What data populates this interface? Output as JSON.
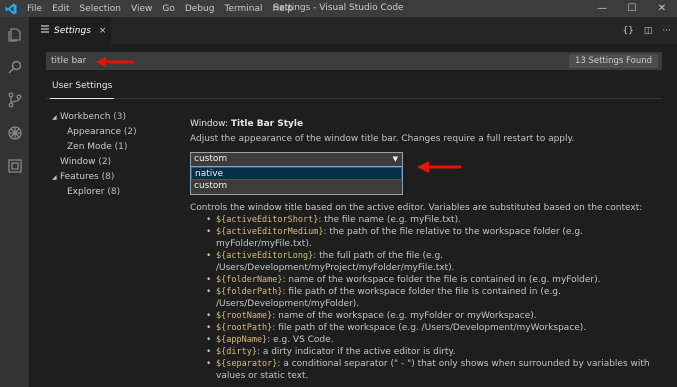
{
  "window": {
    "title": "Settings - Visual Studio Code",
    "menu": [
      "File",
      "Edit",
      "Selection",
      "View",
      "Go",
      "Debug",
      "Terminal",
      "Help"
    ],
    "controls": [
      "—",
      "☐",
      "✕"
    ]
  },
  "activity_bar": {
    "icons": [
      "explorer-icon",
      "search-icon",
      "source-control-icon",
      "debug-icon",
      "extensions-icon"
    ]
  },
  "tab": {
    "label": "Settings",
    "close": "×",
    "actions": [
      "{}",
      "◫",
      "···"
    ]
  },
  "search": {
    "value": "title bar",
    "count": "13 Settings Found"
  },
  "scope_tab": "User Settings",
  "toc": [
    {
      "arrow": "◢",
      "label": "Workbench",
      "count": "(3)",
      "indent": 0
    },
    {
      "arrow": "",
      "label": "Appearance",
      "count": "(2)",
      "indent": 1
    },
    {
      "arrow": "",
      "label": "Zen Mode",
      "count": "(1)",
      "indent": 1
    },
    {
      "arrow": "",
      "label": "Window",
      "count": "(2)",
      "indent": 0
    },
    {
      "arrow": "◢",
      "label": "Features",
      "count": "(8)",
      "indent": 0
    },
    {
      "arrow": "",
      "label": "Explorer",
      "count": "(8)",
      "indent": 1
    }
  ],
  "setting1": {
    "category": "Window: ",
    "name": "Title Bar Style",
    "description": "Adjust the appearance of the window title bar. Changes require a full restart to apply.",
    "selected": "custom",
    "options": [
      "native",
      "custom"
    ]
  },
  "setting2": {
    "title_fragment": "Window: Title",
    "lead": "Controls the window title based on the active editor. Variables are substituted based on the context:",
    "variables": [
      {
        "code": "${activeEditorShort}",
        "text": ": the file name (e.g. myFile.txt)."
      },
      {
        "code": "${activeEditorMedium}",
        "text": ": the path of the file relative to the workspace folder (e.g. myFolder/myFile.txt)."
      },
      {
        "code": "${activeEditorLong}",
        "text": ": the full path of the file (e.g. /Users/Development/myProject/myFolder/myFile.txt)."
      },
      {
        "code": "${folderName}",
        "text": ": name of the workspace folder the file is contained in (e.g. myFolder)."
      },
      {
        "code": "${folderPath}",
        "text": ": file path of the workspace folder the file is contained in (e.g. /Users/Development/myFolder)."
      },
      {
        "code": "${rootName}",
        "text": ": name of the workspace (e.g. myFolder or myWorkspace)."
      },
      {
        "code": "${rootPath}",
        "text": ": file path of the workspace (e.g. /Users/Development/myWorkspace)."
      },
      {
        "code": "${appName}",
        "text": ": e.g. VS Code."
      },
      {
        "code": "${dirty}",
        "text": ": a dirty indicator if the active editor is dirty."
      },
      {
        "code": "${separator}",
        "text": ": a conditional separator (\" - \") that only shows when surrounded by variables with values or static text."
      }
    ]
  },
  "colors": {
    "accent": "#007acc",
    "annotation": "#e51400",
    "code": "#d7ba7d"
  }
}
